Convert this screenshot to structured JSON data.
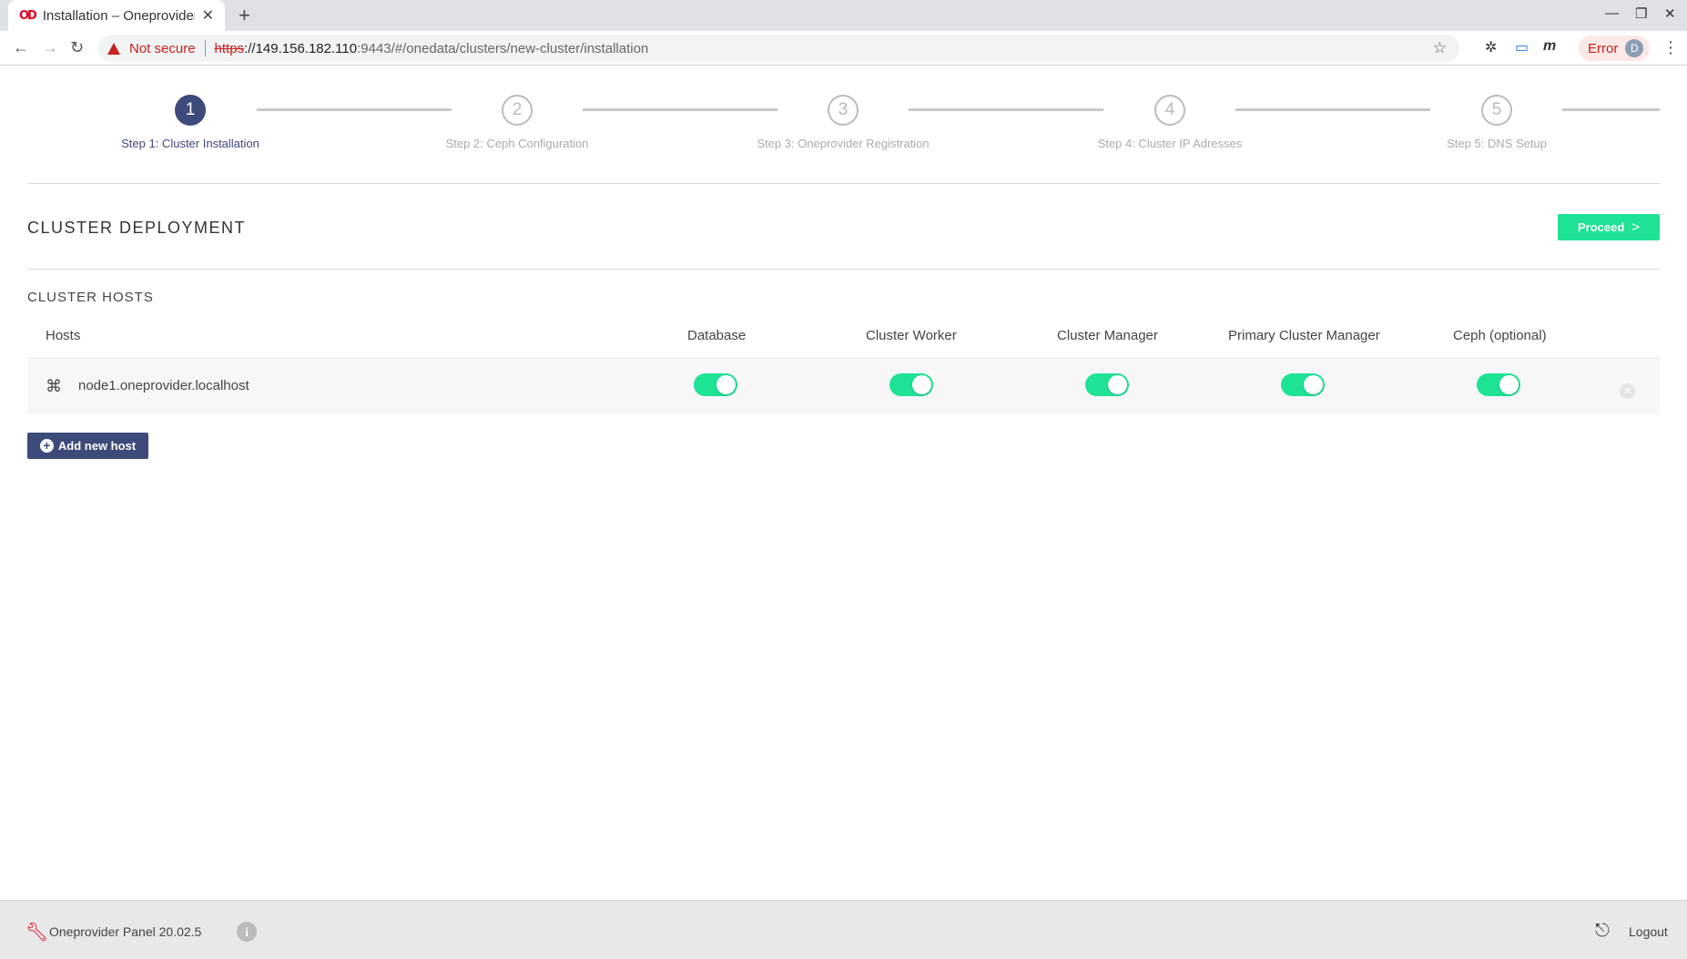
{
  "browser": {
    "tab_title": "Installation – Oneprovider",
    "tab_favicon": "OD",
    "not_secure": "Not secure",
    "url_scheme": "https",
    "url_host": "://149.156.182.110",
    "url_rest": ":9443/#/onedata/clusters/new-cluster/installation",
    "error_label": "Error",
    "avatar_letter": "D"
  },
  "stepper": {
    "steps": [
      {
        "number": "1",
        "label": "Step 1: Cluster Installation",
        "active": true
      },
      {
        "number": "2",
        "label": "Step 2: Ceph Configuration",
        "active": false
      },
      {
        "number": "3",
        "label": "Step 3: Oneprovider Registration",
        "active": false
      },
      {
        "number": "4",
        "label": "Step 4: Cluster IP Adresses",
        "active": false
      },
      {
        "number": "5",
        "label": "Step 5: DNS Setup",
        "active": false
      }
    ]
  },
  "deployment": {
    "title": "CLUSTER DEPLOYMENT",
    "proceed_label": "Proceed"
  },
  "hosts": {
    "title": "CLUSTER HOSTS",
    "columns": [
      "Hosts",
      "Database",
      "Cluster Worker",
      "Cluster Manager",
      "Primary Cluster Manager",
      "Ceph (optional)"
    ],
    "rows": [
      {
        "name": "node1.oneprovider.localhost",
        "database": true,
        "cluster_worker": true,
        "cluster_manager": true,
        "primary_cluster_manager": true,
        "ceph": true
      }
    ],
    "add_label": "Add new host"
  },
  "footer": {
    "panel_name": "Oneprovider Panel 20.02.5",
    "logout_label": "Logout"
  },
  "colors": {
    "accent_green": "#1ee294",
    "primary_blue": "#3e4a7a",
    "brand_red": "#e2001a"
  }
}
